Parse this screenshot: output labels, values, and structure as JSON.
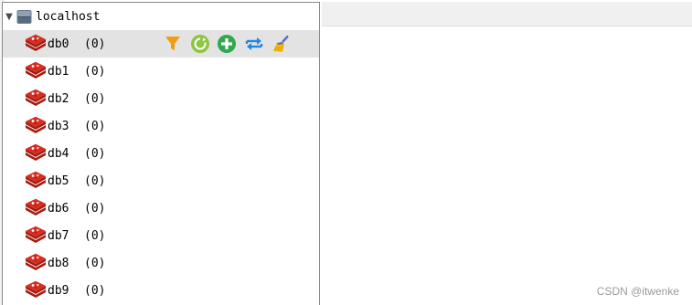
{
  "tree": {
    "host": {
      "label": "localhost",
      "expander": "▼",
      "icon": "server-icon"
    },
    "databases": [
      {
        "label": "db0",
        "count": "(0)",
        "selected": true
      },
      {
        "label": "db1",
        "count": "(0)"
      },
      {
        "label": "db2",
        "count": "(0)"
      },
      {
        "label": "db3",
        "count": "(0)"
      },
      {
        "label": "db4",
        "count": "(0)"
      },
      {
        "label": "db5",
        "count": "(0)"
      },
      {
        "label": "db6",
        "count": "(0)"
      },
      {
        "label": "db7",
        "count": "(0)"
      },
      {
        "label": "db8",
        "count": "(0)"
      },
      {
        "label": "db9",
        "count": "(0)"
      }
    ],
    "row_actions": [
      {
        "name": "filter-icon",
        "color": "#f39c12"
      },
      {
        "name": "reload-icon",
        "color": "#8dc63f"
      },
      {
        "name": "add-key-icon",
        "color": "#2fa84f"
      },
      {
        "name": "flush-icon",
        "color": "#1e88e5"
      },
      {
        "name": "clear-icon",
        "color": "#5a6acf"
      }
    ]
  },
  "watermark": "CSDN @itwenke",
  "colors": {
    "selected_row": "#e3e3e3",
    "redis_red": "#c6302b"
  }
}
